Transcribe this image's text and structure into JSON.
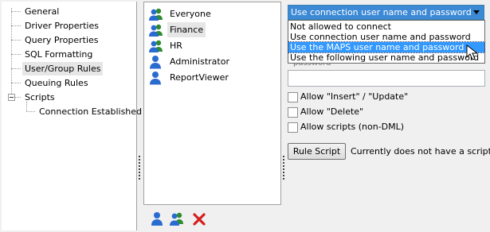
{
  "tree": {
    "items": [
      {
        "label": "General"
      },
      {
        "label": "Driver Properties"
      },
      {
        "label": "Query Properties"
      },
      {
        "label": "SQL Formatting"
      },
      {
        "label": "User/Group Rules",
        "selected": true
      },
      {
        "label": "Queuing Rules"
      },
      {
        "label": "Scripts",
        "expanded": true
      },
      {
        "label": "Connection Established"
      }
    ]
  },
  "users": {
    "items": [
      {
        "label": "Everyone",
        "icon": "group-icon"
      },
      {
        "label": "Finance",
        "icon": "group-icon",
        "selected": true
      },
      {
        "label": "HR",
        "icon": "group-icon"
      },
      {
        "label": "Administrator",
        "icon": "user-icon"
      },
      {
        "label": "ReportViewer",
        "icon": "user-icon"
      }
    ],
    "toolbar": [
      "add-user-icon",
      "add-group-icon",
      "delete-icon"
    ]
  },
  "connection": {
    "selected": "Use connection user name and password",
    "options": [
      "Not allowed to connect",
      "Use connection user name and password",
      "Use the MAPS user name and password",
      "Use the following user name and password"
    ],
    "highlighted_index": 2,
    "partial_label": "password"
  },
  "checkboxes": [
    {
      "label": "Allow \"Insert\" / \"Update\"",
      "checked": false
    },
    {
      "label": "Allow \"Delete\"",
      "checked": false
    },
    {
      "label": "Allow scripts (non-DML)",
      "checked": false
    }
  ],
  "rule_script": {
    "button_label": "Rule Script",
    "status": "Currently does not have a script"
  },
  "colors": {
    "combo_bg": "#3c89d6",
    "highlight": "#3399ff",
    "delete_red": "#d42020"
  }
}
